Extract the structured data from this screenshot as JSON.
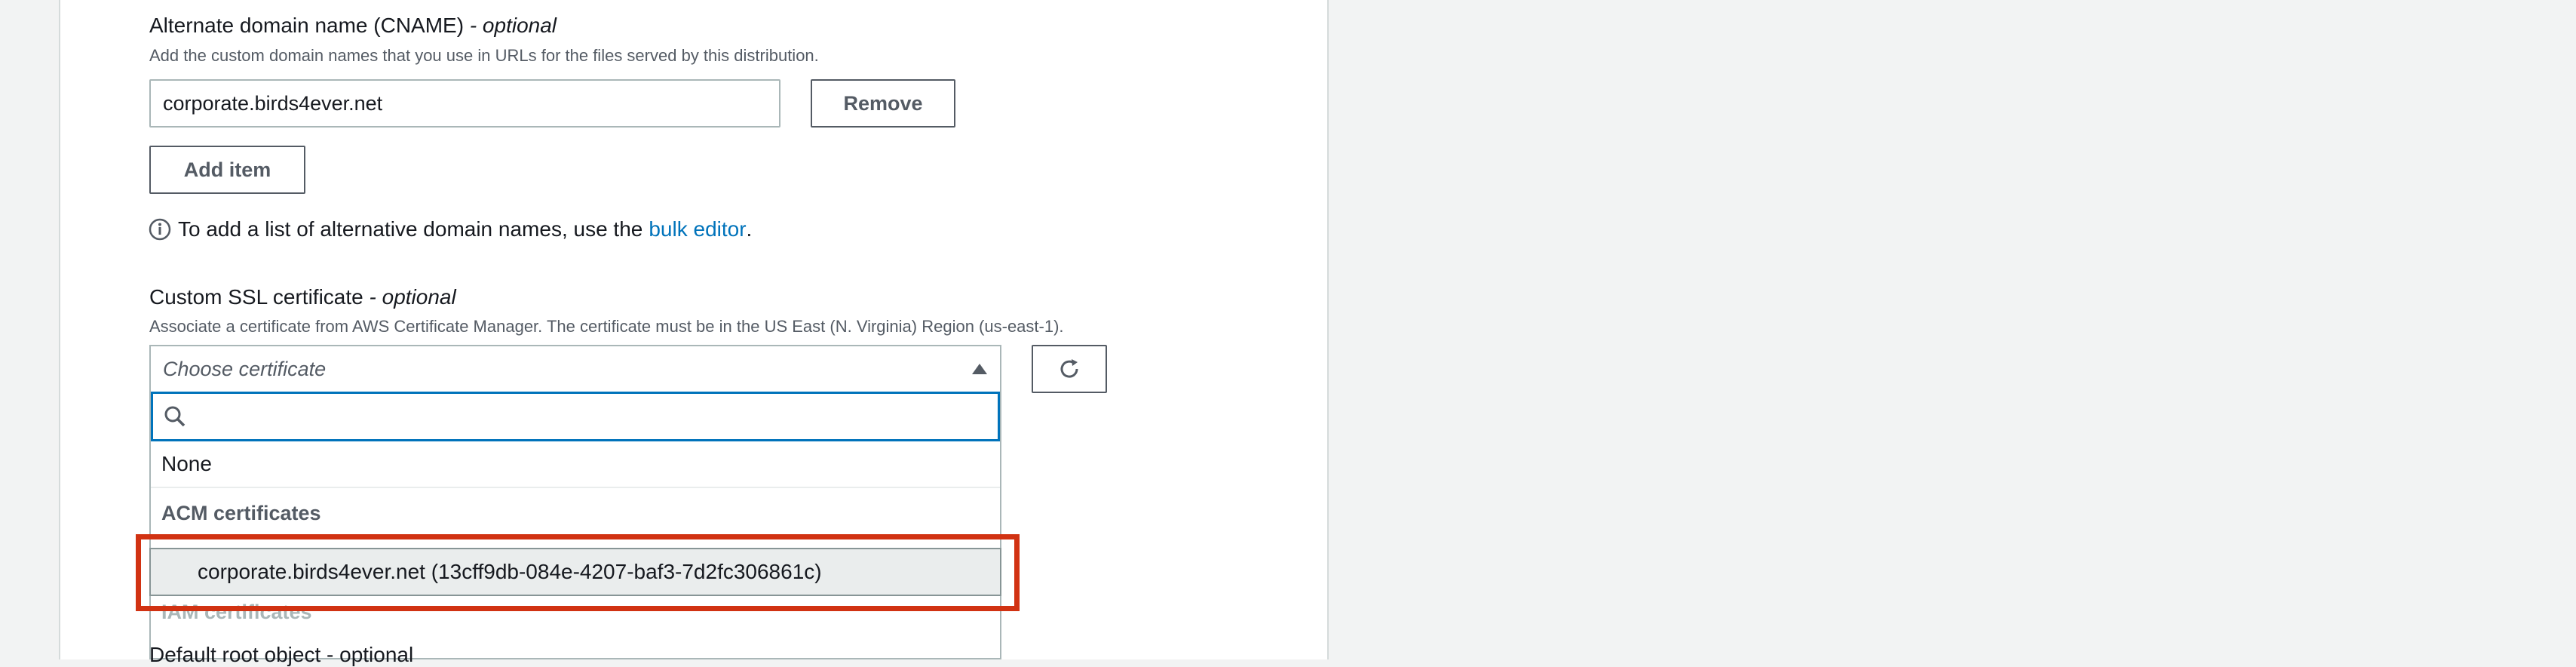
{
  "cname": {
    "label": "Alternate domain name (CNAME)",
    "label_suffix": "- optional",
    "description": "Add the custom domain names that you use in URLs for the files served by this distribution.",
    "items": [
      {
        "value": "corporate.birds4ever.net",
        "remove_label": "Remove"
      }
    ],
    "add_item_label": "Add item",
    "info_text_before": "To add a list of alternative domain names, use the",
    "info_link": "bulk editor",
    "info_text_after": "."
  },
  "ssl": {
    "label": "Custom SSL certificate",
    "label_suffix": "- optional",
    "description": "Associate a certificate from AWS Certificate Manager. The certificate must be in the US East (N. Virginia) Region (us-east-1).",
    "select_placeholder": "Choose certificate",
    "filter_placeholder": "",
    "options": {
      "none_label": "None",
      "acm_group": "ACM certificates",
      "acm_item": "corporate.birds4ever.net (13cff9db-084e-4207-baf3-7d2fc306861c)",
      "iam_group": "IAM certificates"
    }
  },
  "partial_next_label": "Default root object - optional",
  "colors": {
    "link": "#0073bb",
    "highlight": "#d13212",
    "focus": "#0073bb",
    "panel_bg": "#ffffff",
    "page_bg": "#f2f3f3"
  },
  "icons": {
    "info": "info-icon",
    "caret": "caret-up-icon",
    "search": "search-icon",
    "refresh": "refresh-icon"
  }
}
